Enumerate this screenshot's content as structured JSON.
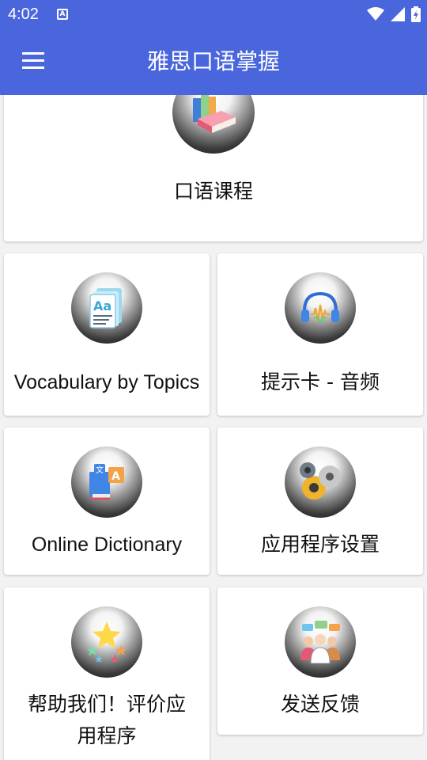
{
  "status_bar": {
    "time": "4:02",
    "notification_icon": "A"
  },
  "app_bar": {
    "title": "雅思口语掌握"
  },
  "cards": {
    "speaking_course": {
      "label": "口语课程",
      "icon": "books-icon"
    },
    "vocabulary": {
      "label": "Vocabulary by Topics",
      "icon": "vocabulary-cards-icon"
    },
    "cue_cards_audio": {
      "label": "提示卡 - 音频",
      "icon": "headphones-icon"
    },
    "online_dictionary": {
      "label": "Online Dictionary",
      "icon": "translation-book-icon"
    },
    "app_settings": {
      "label": "应用程序设置",
      "icon": "gears-icon"
    },
    "rate_app": {
      "label_line1": "帮助我们！评价应",
      "label_line2": "用程序",
      "icon": "stars-icon"
    },
    "feedback": {
      "label": "发送反馈",
      "icon": "people-chat-icon"
    }
  },
  "colors": {
    "primary": "#4a66dd",
    "background": "#f2f2f2",
    "card": "#ffffff"
  }
}
